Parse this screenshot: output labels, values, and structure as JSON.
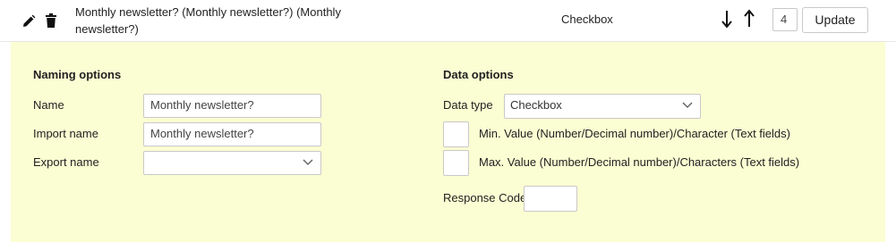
{
  "header": {
    "title": "Monthly newsletter? (Monthly newsletter?) (Monthly newsletter?)",
    "type": "Checkbox",
    "order_value": "4",
    "update_label": "Update",
    "icons": [
      "pencil-icon",
      "trash-icon",
      "arrow-down-icon",
      "arrow-up-icon"
    ]
  },
  "naming": {
    "heading": "Naming options",
    "name_label": "Name",
    "name_value": "Monthly newsletter?",
    "import_label": "Import name",
    "import_value": "Monthly newsletter?",
    "export_label": "Export name",
    "export_value": ""
  },
  "data_options": {
    "heading": "Data options",
    "data_type_label": "Data type",
    "data_type_value": "Checkbox",
    "min_label": "Min. Value (Number/Decimal number)/Character (Text fields)",
    "max_label": "Max. Value (Number/Decimal number)/Characters (Text fields)",
    "response_code_label": "Response Code"
  },
  "colors": {
    "panel_background": "#fbfdd2",
    "border": "#c9c9c9"
  }
}
